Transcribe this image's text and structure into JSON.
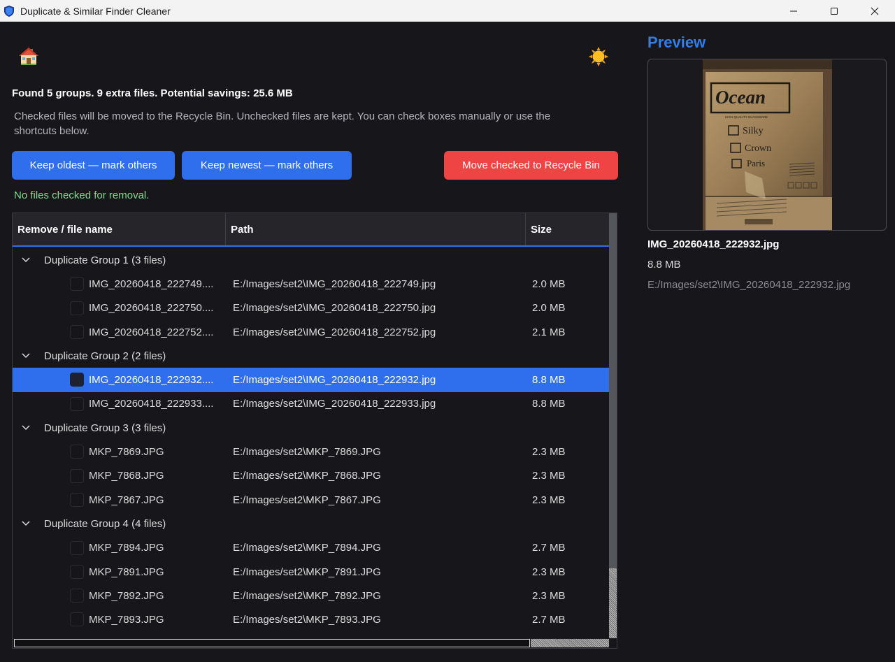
{
  "window": {
    "title": "Duplicate & Similar Finder Cleaner"
  },
  "icons": {
    "app": "shield-icon",
    "home": "house-icon",
    "theme": "sun-icon",
    "expand": "chevron-down-icon",
    "minimize": "minimize-icon",
    "maximize": "maximize-icon",
    "close": "close-icon"
  },
  "summary": "Found 5 groups. 9 extra files. Potential savings: 25.6 MB",
  "help_text": "Checked files will be moved to the Recycle Bin. Unchecked files are kept. You can check boxes manually or use the shortcuts below.",
  "buttons": {
    "keep_oldest": "Keep oldest — mark others",
    "keep_newest": "Keep newest — mark others",
    "move_recycle": "Move checked to Recycle Bin"
  },
  "status": "No files checked for removal.",
  "colors": {
    "accent": "#2f6fee",
    "danger": "#ef4444",
    "success": "#7fdc8f",
    "preview_title": "#2f7fe6"
  },
  "table": {
    "columns": [
      "Remove / file name",
      "Path",
      "Size"
    ],
    "groups": [
      {
        "label": "Duplicate Group 1 (3 files)",
        "files": [
          {
            "name": "IMG_20260418_222749.jpg",
            "path": "E:/Images/set2\\IMG_20260418_222749.jpg",
            "size": "2.0 MB",
            "checked": false
          },
          {
            "name": "IMG_20260418_222750.jpg",
            "path": "E:/Images/set2\\IMG_20260418_222750.jpg",
            "size": "2.0 MB",
            "checked": false
          },
          {
            "name": "IMG_20260418_222752.jpg",
            "path": "E:/Images/set2\\IMG_20260418_222752.jpg",
            "size": "2.1 MB",
            "checked": false
          }
        ]
      },
      {
        "label": "Duplicate Group 2 (2 files)",
        "files": [
          {
            "name": "IMG_20260418_222932.jpg",
            "path": "E:/Images/set2\\IMG_20260418_222932.jpg",
            "size": "8.8 MB",
            "checked": false,
            "selected": true
          },
          {
            "name": "IMG_20260418_222933.jpg",
            "path": "E:/Images/set2\\IMG_20260418_222933.jpg",
            "size": "8.8 MB",
            "checked": false
          }
        ]
      },
      {
        "label": "Duplicate Group 3 (3 files)",
        "files": [
          {
            "name": "MKP_7869.JPG",
            "path": "E:/Images/set2\\MKP_7869.JPG",
            "size": "2.3 MB",
            "checked": false
          },
          {
            "name": "MKP_7868.JPG",
            "path": "E:/Images/set2\\MKP_7868.JPG",
            "size": "2.3 MB",
            "checked": false
          },
          {
            "name": "MKP_7867.JPG",
            "path": "E:/Images/set2\\MKP_7867.JPG",
            "size": "2.3 MB",
            "checked": false
          }
        ]
      },
      {
        "label": "Duplicate Group 4 (4 files)",
        "files": [
          {
            "name": "MKP_7894.JPG",
            "path": "E:/Images/set2\\MKP_7894.JPG",
            "size": "2.7 MB",
            "checked": false
          },
          {
            "name": "MKP_7891.JPG",
            "path": "E:/Images/set2\\MKP_7891.JPG",
            "size": "2.3 MB",
            "checked": false
          },
          {
            "name": "MKP_7892.JPG",
            "path": "E:/Images/set2\\MKP_7892.JPG",
            "size": "2.3 MB",
            "checked": false
          },
          {
            "name": "MKP_7893.JPG",
            "path": "E:/Images/set2\\MKP_7893.JPG",
            "size": "2.7 MB",
            "checked": false
          }
        ]
      }
    ]
  },
  "preview": {
    "title": "Preview",
    "image_text": {
      "brand": "Ocean",
      "tagline": "HIGH QUALITY GLASSWARE",
      "options": [
        "Silky",
        "Crown",
        "Paris"
      ]
    },
    "filename": "IMG_20260418_222932.jpg",
    "size": "8.8 MB",
    "path": "E:/Images/set2\\IMG_20260418_222932.jpg"
  }
}
